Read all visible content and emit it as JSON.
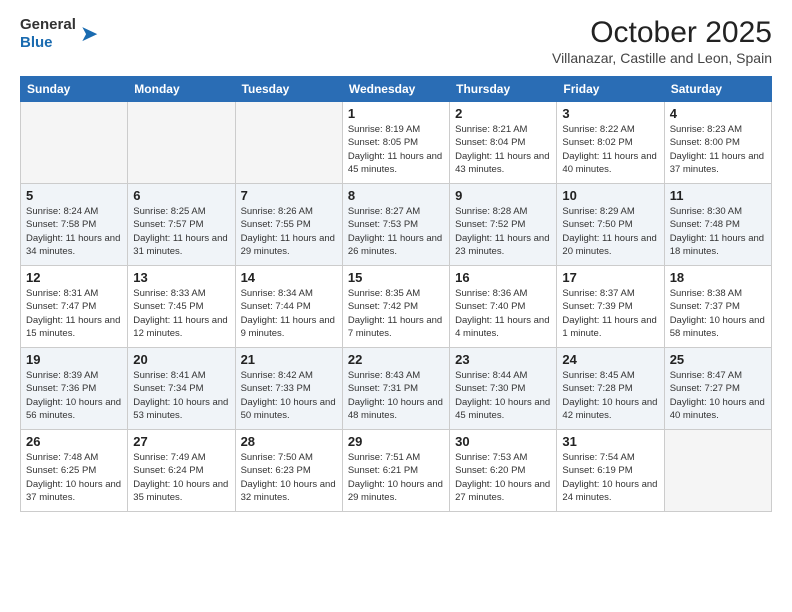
{
  "logo": {
    "general": "General",
    "blue": "Blue"
  },
  "title": "October 2025",
  "location": "Villanazar, Castille and Leon, Spain",
  "weekdays": [
    "Sunday",
    "Monday",
    "Tuesday",
    "Wednesday",
    "Thursday",
    "Friday",
    "Saturday"
  ],
  "weeks": [
    [
      {
        "day": "",
        "info": ""
      },
      {
        "day": "",
        "info": ""
      },
      {
        "day": "",
        "info": ""
      },
      {
        "day": "1",
        "info": "Sunrise: 8:19 AM\nSunset: 8:05 PM\nDaylight: 11 hours\nand 45 minutes."
      },
      {
        "day": "2",
        "info": "Sunrise: 8:21 AM\nSunset: 8:04 PM\nDaylight: 11 hours\nand 43 minutes."
      },
      {
        "day": "3",
        "info": "Sunrise: 8:22 AM\nSunset: 8:02 PM\nDaylight: 11 hours\nand 40 minutes."
      },
      {
        "day": "4",
        "info": "Sunrise: 8:23 AM\nSunset: 8:00 PM\nDaylight: 11 hours\nand 37 minutes."
      }
    ],
    [
      {
        "day": "5",
        "info": "Sunrise: 8:24 AM\nSunset: 7:58 PM\nDaylight: 11 hours\nand 34 minutes."
      },
      {
        "day": "6",
        "info": "Sunrise: 8:25 AM\nSunset: 7:57 PM\nDaylight: 11 hours\nand 31 minutes."
      },
      {
        "day": "7",
        "info": "Sunrise: 8:26 AM\nSunset: 7:55 PM\nDaylight: 11 hours\nand 29 minutes."
      },
      {
        "day": "8",
        "info": "Sunrise: 8:27 AM\nSunset: 7:53 PM\nDaylight: 11 hours\nand 26 minutes."
      },
      {
        "day": "9",
        "info": "Sunrise: 8:28 AM\nSunset: 7:52 PM\nDaylight: 11 hours\nand 23 minutes."
      },
      {
        "day": "10",
        "info": "Sunrise: 8:29 AM\nSunset: 7:50 PM\nDaylight: 11 hours\nand 20 minutes."
      },
      {
        "day": "11",
        "info": "Sunrise: 8:30 AM\nSunset: 7:48 PM\nDaylight: 11 hours\nand 18 minutes."
      }
    ],
    [
      {
        "day": "12",
        "info": "Sunrise: 8:31 AM\nSunset: 7:47 PM\nDaylight: 11 hours\nand 15 minutes."
      },
      {
        "day": "13",
        "info": "Sunrise: 8:33 AM\nSunset: 7:45 PM\nDaylight: 11 hours\nand 12 minutes."
      },
      {
        "day": "14",
        "info": "Sunrise: 8:34 AM\nSunset: 7:44 PM\nDaylight: 11 hours\nand 9 minutes."
      },
      {
        "day": "15",
        "info": "Sunrise: 8:35 AM\nSunset: 7:42 PM\nDaylight: 11 hours\nand 7 minutes."
      },
      {
        "day": "16",
        "info": "Sunrise: 8:36 AM\nSunset: 7:40 PM\nDaylight: 11 hours\nand 4 minutes."
      },
      {
        "day": "17",
        "info": "Sunrise: 8:37 AM\nSunset: 7:39 PM\nDaylight: 11 hours\nand 1 minute."
      },
      {
        "day": "18",
        "info": "Sunrise: 8:38 AM\nSunset: 7:37 PM\nDaylight: 10 hours\nand 58 minutes."
      }
    ],
    [
      {
        "day": "19",
        "info": "Sunrise: 8:39 AM\nSunset: 7:36 PM\nDaylight: 10 hours\nand 56 minutes."
      },
      {
        "day": "20",
        "info": "Sunrise: 8:41 AM\nSunset: 7:34 PM\nDaylight: 10 hours\nand 53 minutes."
      },
      {
        "day": "21",
        "info": "Sunrise: 8:42 AM\nSunset: 7:33 PM\nDaylight: 10 hours\nand 50 minutes."
      },
      {
        "day": "22",
        "info": "Sunrise: 8:43 AM\nSunset: 7:31 PM\nDaylight: 10 hours\nand 48 minutes."
      },
      {
        "day": "23",
        "info": "Sunrise: 8:44 AM\nSunset: 7:30 PM\nDaylight: 10 hours\nand 45 minutes."
      },
      {
        "day": "24",
        "info": "Sunrise: 8:45 AM\nSunset: 7:28 PM\nDaylight: 10 hours\nand 42 minutes."
      },
      {
        "day": "25",
        "info": "Sunrise: 8:47 AM\nSunset: 7:27 PM\nDaylight: 10 hours\nand 40 minutes."
      }
    ],
    [
      {
        "day": "26",
        "info": "Sunrise: 7:48 AM\nSunset: 6:25 PM\nDaylight: 10 hours\nand 37 minutes."
      },
      {
        "day": "27",
        "info": "Sunrise: 7:49 AM\nSunset: 6:24 PM\nDaylight: 10 hours\nand 35 minutes."
      },
      {
        "day": "28",
        "info": "Sunrise: 7:50 AM\nSunset: 6:23 PM\nDaylight: 10 hours\nand 32 minutes."
      },
      {
        "day": "29",
        "info": "Sunrise: 7:51 AM\nSunset: 6:21 PM\nDaylight: 10 hours\nand 29 minutes."
      },
      {
        "day": "30",
        "info": "Sunrise: 7:53 AM\nSunset: 6:20 PM\nDaylight: 10 hours\nand 27 minutes."
      },
      {
        "day": "31",
        "info": "Sunrise: 7:54 AM\nSunset: 6:19 PM\nDaylight: 10 hours\nand 24 minutes."
      },
      {
        "day": "",
        "info": ""
      }
    ]
  ]
}
